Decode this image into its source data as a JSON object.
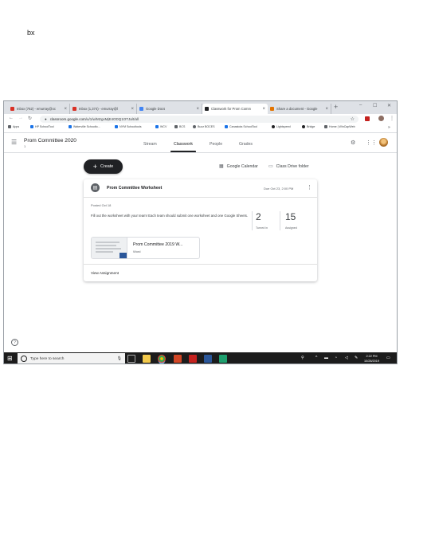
{
  "page_label": "bx",
  "browser": {
    "tabs": [
      {
        "label": "Inbox (762) - emurray@oc",
        "favicon": "gmail-icon",
        "color": "#d93025",
        "active": false
      },
      {
        "label": "Inbox (1,374) - emurray@l",
        "favicon": "gmail-icon",
        "color": "#d93025",
        "active": false
      },
      {
        "label": "Google Docs",
        "favicon": "docs-icon",
        "color": "#4285f4",
        "active": false
      },
      {
        "label": "Classwork for Prom Comm",
        "favicon": "classroom-icon",
        "color": "#202124",
        "active": true
      },
      {
        "label": "Share a document - Google",
        "favicon": "shield-icon",
        "color": "#e37400",
        "active": false
      }
    ],
    "url_host": "classroom.google.com",
    "url_path": "/u/1/w/MzgxMjE4ODQ1OTJa/t/all",
    "bookmarks": [
      {
        "label": "Apps",
        "color": "#5f6368"
      },
      {
        "label": "HP SchoolTool",
        "color": "#1a73e8"
      },
      {
        "label": "Waterville Schoolto...",
        "color": "#1a73e8"
      },
      {
        "label": "NYM Schooltools",
        "color": "#1a73e8"
      },
      {
        "label": "WCV",
        "color": "#1a73e8"
      },
      {
        "label": "BCS",
        "color": "#5f6368"
      },
      {
        "label": "Buzz BOCES",
        "color": "#5f6368"
      },
      {
        "label": "Canastota SchoolTool",
        "color": "#1a73e8"
      },
      {
        "label": "Lightspeed",
        "color": "#202124"
      },
      {
        "label": "Bridge",
        "color": "#202124"
      },
      {
        "label": "Home | WinCapWeb",
        "color": "#5f6368"
      }
    ]
  },
  "classroom": {
    "class_name": "Prom Committee 2020",
    "class_sub": "1",
    "nav_tabs": [
      "Stream",
      "Classwork",
      "People",
      "Grades"
    ],
    "active_tab": "Classwork",
    "create_label": "Create",
    "calendar_label": "Google Calendar",
    "drive_label": "Class Drive folder"
  },
  "assignment": {
    "title": "Prom Committee Worksheet",
    "due": "Due Oct 23, 2:00 PM",
    "posted": "Posted Oct 18",
    "instructions": "Fill out the worksheet with your team! Each team should submit one worksheet and one Google Sheets.",
    "turned_in": "2",
    "turned_in_label": "Turned in",
    "assigned": "15",
    "assigned_label": "Assigned",
    "attachment_title": "Prom Committee 2019 W...",
    "attachment_type": "Word",
    "view_label": "View Assignment"
  },
  "taskbar": {
    "search_placeholder": "Type here to search",
    "time": "2:22 PM",
    "date": "10/28/2019"
  }
}
